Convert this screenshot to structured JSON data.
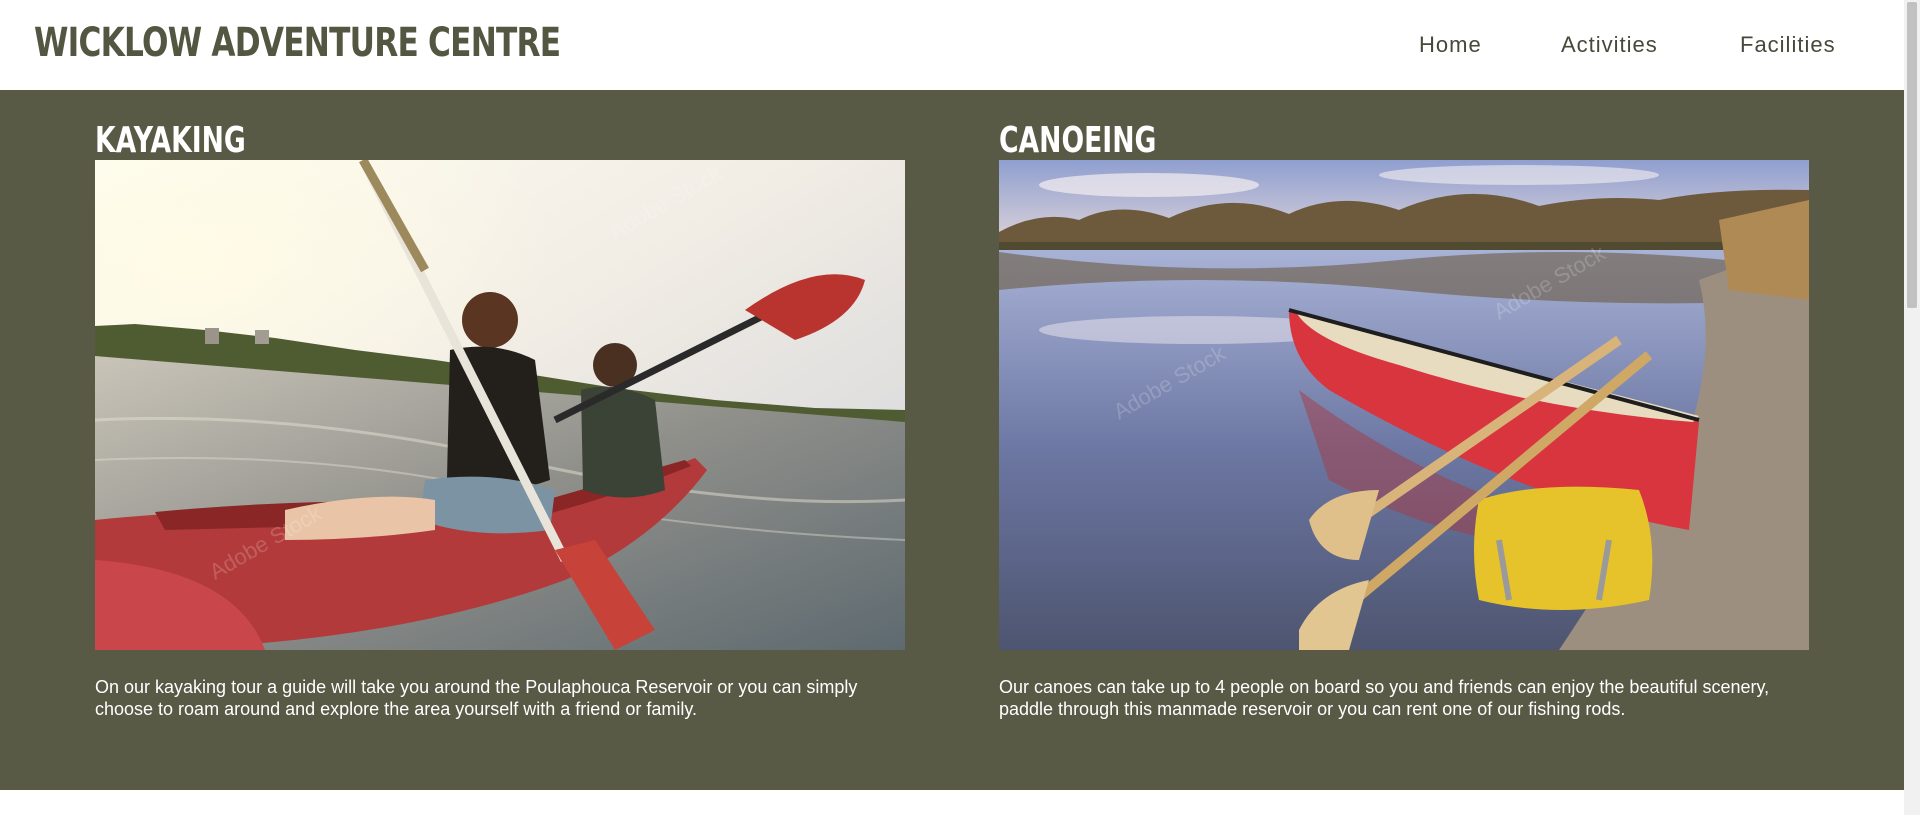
{
  "site": {
    "title": "WICKLOW ADVENTURE CENTRE"
  },
  "nav": {
    "items": [
      "Home",
      "Activities",
      "Facilities"
    ]
  },
  "activities": [
    {
      "title": "KAYAKING",
      "description": "On our kayaking tour a guide will take you around the Poulaphouca Reservoir or you can simply choose to roam around and explore the area yourself with a friend or family.",
      "image": "kayak-couple-photo"
    },
    {
      "title": "CANOEING",
      "description": "Our canoes can take up to 4 people on board so you and friends can enjoy the beautiful scenery, paddle through this manmade reservoir or you can rent one of our fishing rods.",
      "image": "red-canoe-photo"
    }
  ],
  "colors": {
    "band": "#585a45",
    "logo": "#535640",
    "nav_text": "#46483a"
  }
}
